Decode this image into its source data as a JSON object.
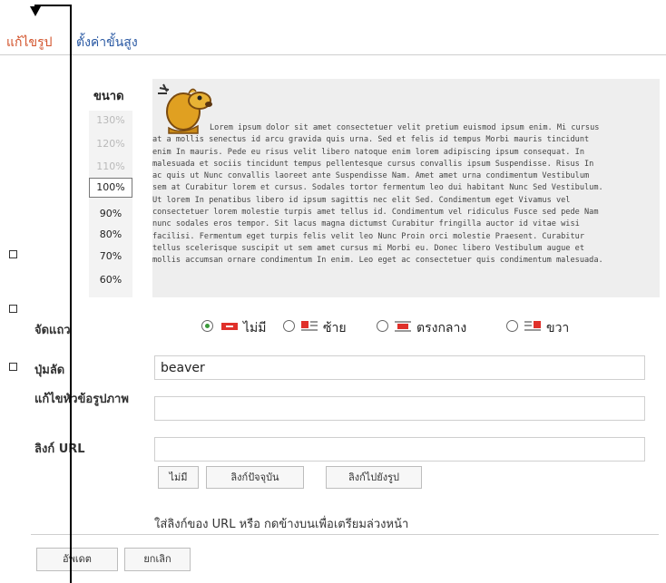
{
  "tabs": {
    "edit": "แก้ไขรูป",
    "advanced": "ตั้งค่าขั้นสูง"
  },
  "size": {
    "label": "ขนาด",
    "options": [
      "130%",
      "120%",
      "110%",
      "100%",
      "90%",
      "80%",
      "70%",
      "60%"
    ],
    "selected": "100%"
  },
  "preview": {
    "lines": [
      "Lorem ipsum dolor sit amet consectetuer velit pretium euismod ipsum enim. Mi cursus",
      "at a mollis senectus id arcu gravida quis urna. Sed et felis id tempus Morbi mauris tincidunt",
      "enim In mauris. Pede eu risus velit libero natoque enim lorem adipiscing ipsum consequat. In",
      "malesuada et sociis tincidunt tempus pellentesque cursus convallis ipsum Suspendisse. Risus In",
      "ac quis ut Nunc convallis laoreet ante Suspendisse Nam. Amet amet urna condimentum Vestibulum",
      "sem at Curabitur lorem et cursus. Sodales tortor fermentum leo dui habitant Nunc Sed Vestibulum.",
      "Ut lorem In penatibus libero id ipsum sagittis nec elit Sed. Condimentum eget Vivamus vel",
      "consectetuer lorem molestie turpis amet tellus id. Condimentum vel ridiculus Fusce sed pede Nam",
      "nunc sodales eros tempor. Sit lacus magna dictumst Curabitur fringilla auctor id vitae wisi",
      "facilisi. Fermentum eget turpis felis velit leo Nunc Proin orci molestie Praesent. Curabitur",
      "tellus scelerisque suscipit ut sem amet cursus mi Morbi eu. Donec libero Vestibulum augue et",
      "mollis accumsan ornare condimentum In enim. Leo eget ac consectetuer quis condimentum malesuada."
    ]
  },
  "alignment": {
    "label": "จัดแถว",
    "options": [
      "ไม่มี",
      "ซ้าย",
      "ตรงกลาง",
      "ขวา"
    ],
    "selected": "ไม่มี",
    "icon_red": "#e0302a",
    "radio_green": "#3a9a3a"
  },
  "shortcut": {
    "label": "ปุ่มลัด",
    "value": "beaver"
  },
  "caption": {
    "label": "แก้ไขหัวข้อรูปภาพ",
    "value": ""
  },
  "link": {
    "label": "ลิงก์ URL",
    "value": "",
    "buttons": {
      "none": "ไม่มี",
      "current": "ลิงก์ปัจจุบัน",
      "to_image": "ลิงก์ไปยังรูป"
    },
    "hint": "ใส่ลิงก์ของ URL หรือ กดข้างบนเพื่อเตรียมล่วงหน้า"
  },
  "actions": {
    "update": "อัพเดต",
    "cancel": "ยกเลิก"
  }
}
